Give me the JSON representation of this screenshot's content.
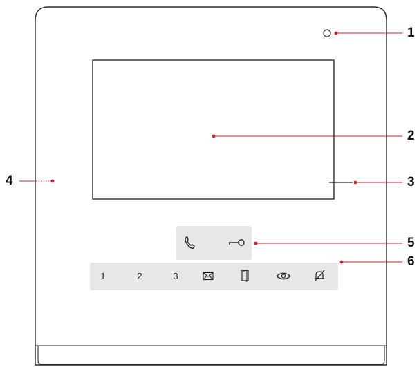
{
  "device": {
    "name": "video-intercom-monitor",
    "call_panel": {
      "buttons": [
        {
          "icon": "handset-icon"
        },
        {
          "icon": "key-icon"
        }
      ]
    },
    "button_panel": {
      "buttons": [
        {
          "label": "1"
        },
        {
          "label": "2"
        },
        {
          "label": "3"
        },
        {
          "icon": "envelope-icon"
        },
        {
          "icon": "door-icon"
        },
        {
          "icon": "eye-icon"
        },
        {
          "icon": "bell-mute-icon"
        }
      ]
    }
  },
  "callouts": [
    {
      "number": "1",
      "target": "camera"
    },
    {
      "number": "2",
      "target": "screen"
    },
    {
      "number": "3",
      "target": "microphone"
    },
    {
      "number": "4",
      "target": "speaker"
    },
    {
      "number": "5",
      "target": "call-panel"
    },
    {
      "number": "6",
      "target": "button-panel"
    }
  ],
  "colors": {
    "leader_line": "#d81e2c",
    "outline": "#2a2a2a",
    "panel": "#e5e7e9"
  }
}
